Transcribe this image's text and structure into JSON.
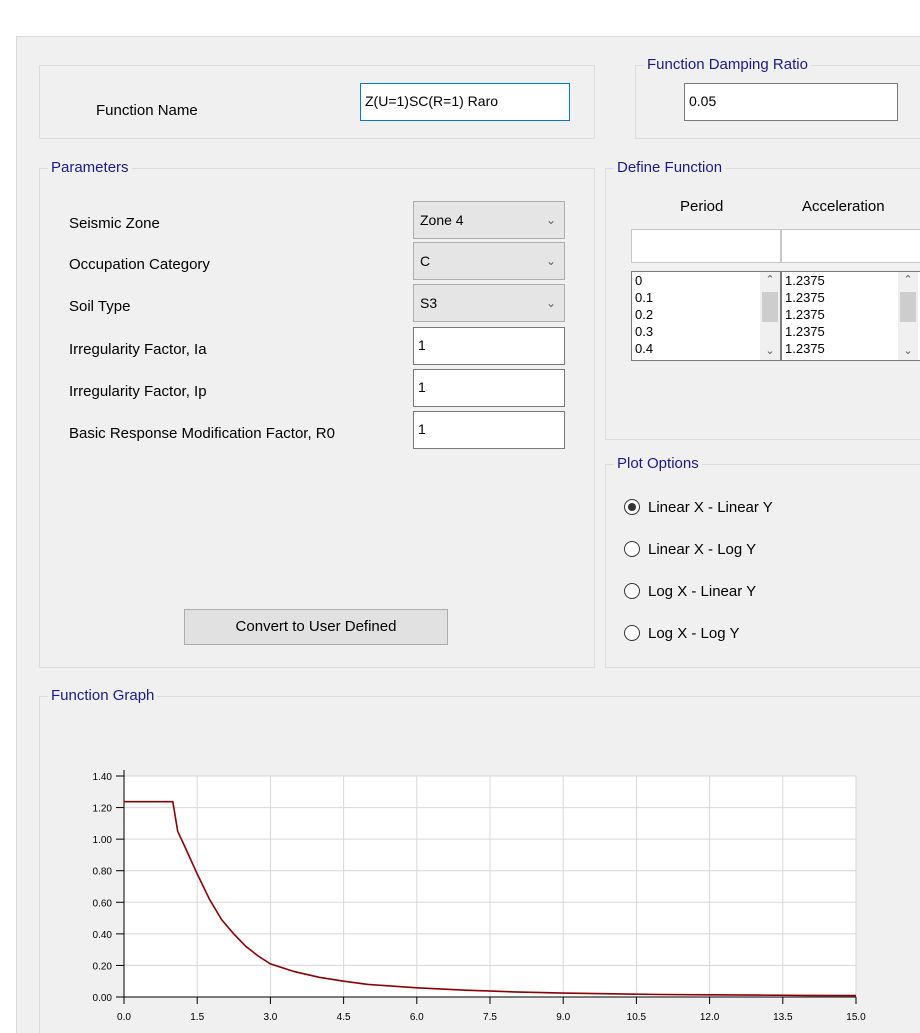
{
  "function_name": {
    "label": "Function Name",
    "value": "Z(U=1)SC(R=1) Raro"
  },
  "damping": {
    "group_label": "Function Damping Ratio",
    "value": "0.05"
  },
  "parameters": {
    "group_label": "Parameters",
    "seismic_zone": {
      "label": "Seismic Zone",
      "value": "Zone 4"
    },
    "occupation_category": {
      "label": "Occupation Category",
      "value": "C"
    },
    "soil_type": {
      "label": "Soil Type",
      "value": "S3"
    },
    "irregularity_ia": {
      "label": "Irregularity Factor, Ia",
      "value": "1"
    },
    "irregularity_ip": {
      "label": "Irregularity Factor, Ip",
      "value": "1"
    },
    "basic_r0": {
      "label": "Basic Response Modification Factor, R0",
      "value": "1"
    },
    "convert_button": "Convert to User Defined"
  },
  "define_function": {
    "group_label": "Define Function",
    "period_header": "Period",
    "acceleration_header": "Acceleration",
    "periods": [
      "0",
      "0.1",
      "0.2",
      "0.3",
      "0.4"
    ],
    "accelerations": [
      "1.2375",
      "1.2375",
      "1.2375",
      "1.2375",
      "1.2375"
    ]
  },
  "plot_options": {
    "group_label": "Plot Options",
    "options": [
      {
        "label": "Linear X - Linear Y",
        "checked": true
      },
      {
        "label": "Linear X - Log Y",
        "checked": false
      },
      {
        "label": "Log X - Linear Y",
        "checked": false
      },
      {
        "label": "Log X - Log Y",
        "checked": false
      }
    ]
  },
  "graph": {
    "group_label": "Function Graph"
  },
  "chart_data": {
    "type": "line",
    "xlim": [
      0,
      15
    ],
    "ylim": [
      0,
      1.4
    ],
    "x_ticks": [
      "0.0",
      "1.5",
      "3.0",
      "4.5",
      "6.0",
      "7.5",
      "9.0",
      "10.5",
      "12.0",
      "13.5",
      "15.0"
    ],
    "y_ticks": [
      "0.00",
      "0.20",
      "0.40",
      "0.60",
      "0.80",
      "1.00",
      "1.20",
      "1.40"
    ],
    "grid": true,
    "line_color": "#8b0000",
    "x": [
      0,
      1.0,
      1.1,
      1.25,
      1.5,
      1.75,
      2.0,
      2.25,
      2.5,
      2.75,
      3.0,
      3.5,
      4.0,
      4.5,
      5.0,
      6.0,
      7.0,
      8.0,
      9.0,
      10.0,
      11.0,
      12.0,
      13.0,
      14.0,
      15.0
    ],
    "y": [
      1.2375,
      1.2375,
      1.05,
      0.95,
      0.78,
      0.62,
      0.49,
      0.4,
      0.32,
      0.26,
      0.21,
      0.16,
      0.125,
      0.1,
      0.08,
      0.058,
      0.043,
      0.032,
      0.025,
      0.02,
      0.016,
      0.014,
      0.012,
      0.01,
      0.009
    ]
  }
}
